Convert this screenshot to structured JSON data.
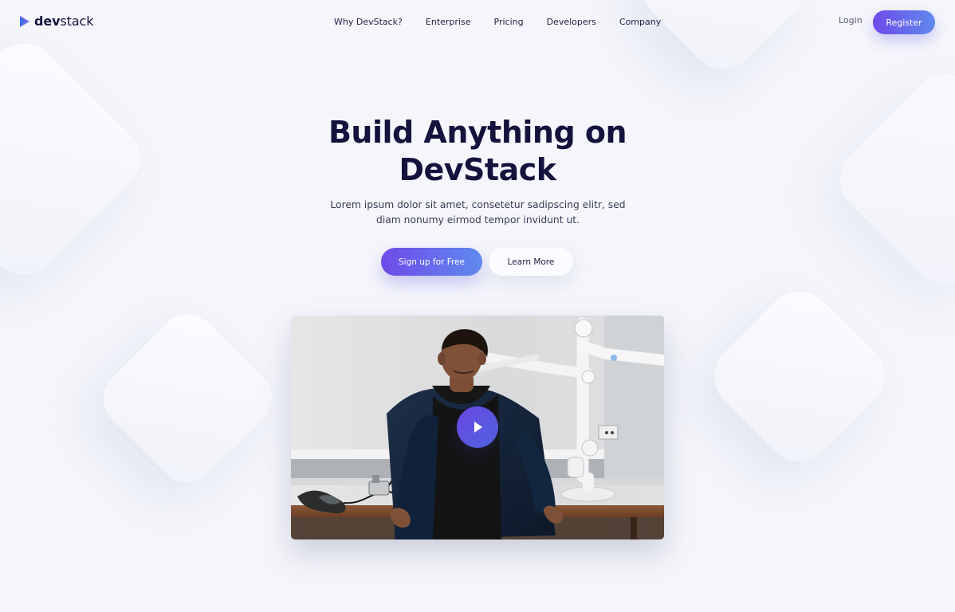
{
  "brand": {
    "name_bold": "dev",
    "name_rest": "stack",
    "logo_icon": "play-triangle-logo",
    "accent": "#6756e7"
  },
  "nav": {
    "items": [
      {
        "label": "Why DevStack?"
      },
      {
        "label": "Enterprise"
      },
      {
        "label": "Pricing"
      },
      {
        "label": "Developers"
      },
      {
        "label": "Company"
      }
    ],
    "login_label": "Login",
    "register_label": "Register"
  },
  "hero": {
    "title": "Build Anything on DevStack",
    "description": "Lorem ipsum dolor sit amet, consetetur sadipscing elitr, sed diam nonumy eirmod tempor invidunt ut.",
    "primary_button": "Sign up for Free",
    "secondary_button": "Learn More"
  },
  "video": {
    "play_icon": "play-icon"
  },
  "colors": {
    "primary_gradient_start": "#6f4ae9",
    "primary_gradient_end": "#5f8aee",
    "heading": "#15123d",
    "background": "#f5f6fb"
  }
}
